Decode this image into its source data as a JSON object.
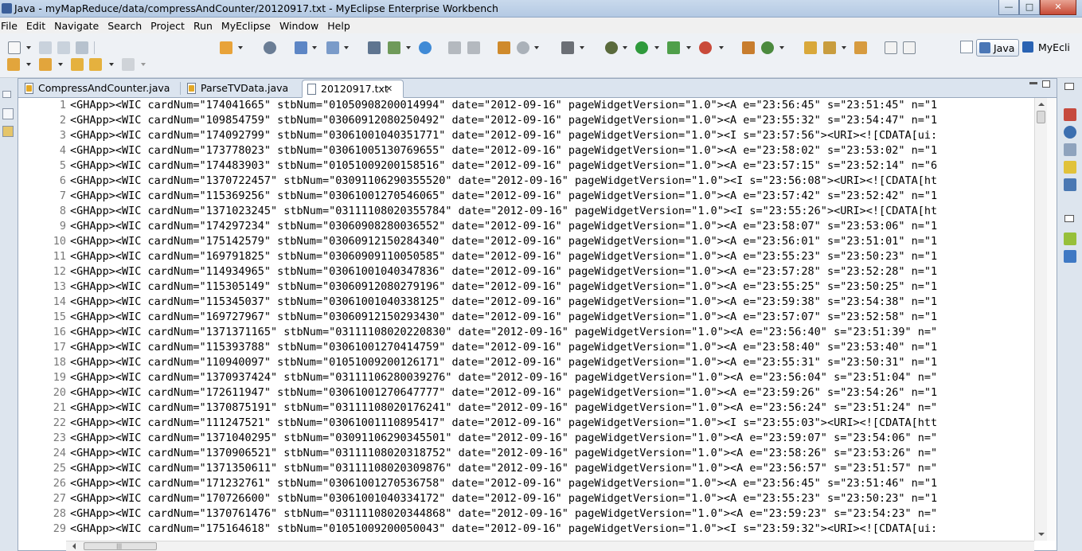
{
  "window": {
    "title": "Java - myMapReduce/data/compressAndCounter/20120917.txt - MyEclipse Enterprise Workbench",
    "minimize": "—",
    "maximize": "□",
    "close": "✕"
  },
  "menu": [
    "File",
    "Edit",
    "Navigate",
    "Search",
    "Project",
    "Run",
    "MyEclipse",
    "Window",
    "Help"
  ],
  "perspectives": {
    "active": "Java",
    "other": "MyEcli"
  },
  "tabs": [
    {
      "label": "CompressAndCounter.java",
      "active": false
    },
    {
      "label": "ParseTVData.java",
      "active": false
    },
    {
      "label": "20120917.txt",
      "active": true,
      "close": "✕"
    }
  ],
  "editor": {
    "lines": [
      {
        "n": "1",
        "t": "<GHApp><WIC cardNum=\"174041665\" stbNum=\"01050908200014994\" date=\"2012-09-16\" pageWidgetVersion=\"1.0\"><A e=\"23:56:45\" s=\"23:51:45\" n=\"1"
      },
      {
        "n": "2",
        "t": "<GHApp><WIC cardNum=\"109854759\" stbNum=\"03060912080250492\" date=\"2012-09-16\" pageWidgetVersion=\"1.0\"><A e=\"23:55:32\" s=\"23:54:47\" n=\"1"
      },
      {
        "n": "3",
        "t": "<GHApp><WIC cardNum=\"174092799\" stbNum=\"03061001040351771\" date=\"2012-09-16\" pageWidgetVersion=\"1.0\"><I s=\"23:57:56\"><URI><![CDATA[ui:"
      },
      {
        "n": "4",
        "t": "<GHApp><WIC cardNum=\"173778023\" stbNum=\"03061005130769655\" date=\"2012-09-16\" pageWidgetVersion=\"1.0\"><A e=\"23:58:02\" s=\"23:53:02\" n=\"1"
      },
      {
        "n": "5",
        "t": "<GHApp><WIC cardNum=\"174483903\" stbNum=\"01051009200158516\" date=\"2012-09-16\" pageWidgetVersion=\"1.0\"><A e=\"23:57:15\" s=\"23:52:14\" n=\"6"
      },
      {
        "n": "6",
        "t": "<GHApp><WIC cardNum=\"1370722457\" stbNum=\"03091106290355520\" date=\"2012-09-16\" pageWidgetVersion=\"1.0\"><I s=\"23:56:08\"><URI><![CDATA[ht"
      },
      {
        "n": "7",
        "t": "<GHApp><WIC cardNum=\"115369256\" stbNum=\"03061001270546065\" date=\"2012-09-16\" pageWidgetVersion=\"1.0\"><A e=\"23:57:42\" s=\"23:52:42\" n=\"1"
      },
      {
        "n": "8",
        "t": "<GHApp><WIC cardNum=\"1371023245\" stbNum=\"03111108020355784\" date=\"2012-09-16\" pageWidgetVersion=\"1.0\"><I s=\"23:55:26\"><URI><![CDATA[ht"
      },
      {
        "n": "9",
        "t": "<GHApp><WIC cardNum=\"174297234\" stbNum=\"03060908280036552\" date=\"2012-09-16\" pageWidgetVersion=\"1.0\"><A e=\"23:58:07\" s=\"23:53:06\" n=\"1"
      },
      {
        "n": "10",
        "t": "<GHApp><WIC cardNum=\"175142579\" stbNum=\"03060912150284340\" date=\"2012-09-16\" pageWidgetVersion=\"1.0\"><A e=\"23:56:01\" s=\"23:51:01\" n=\"1"
      },
      {
        "n": "11",
        "t": "<GHApp><WIC cardNum=\"169791825\" stbNum=\"03060909110050585\" date=\"2012-09-16\" pageWidgetVersion=\"1.0\"><A e=\"23:55:23\" s=\"23:50:23\" n=\"1"
      },
      {
        "n": "12",
        "t": "<GHApp><WIC cardNum=\"114934965\" stbNum=\"03061001040347836\" date=\"2012-09-16\" pageWidgetVersion=\"1.0\"><A e=\"23:57:28\" s=\"23:52:28\" n=\"1"
      },
      {
        "n": "13",
        "t": "<GHApp><WIC cardNum=\"115305149\" stbNum=\"03060912080279196\" date=\"2012-09-16\" pageWidgetVersion=\"1.0\"><A e=\"23:55:25\" s=\"23:50:25\" n=\"1"
      },
      {
        "n": "14",
        "t": "<GHApp><WIC cardNum=\"115345037\" stbNum=\"03061001040338125\" date=\"2012-09-16\" pageWidgetVersion=\"1.0\"><A e=\"23:59:38\" s=\"23:54:38\" n=\"1"
      },
      {
        "n": "15",
        "t": "<GHApp><WIC cardNum=\"169727967\" stbNum=\"03060912150293430\" date=\"2012-09-16\" pageWidgetVersion=\"1.0\"><A e=\"23:57:07\" s=\"23:52:58\" n=\"1"
      },
      {
        "n": "16",
        "t": "<GHApp><WIC cardNum=\"1371371165\" stbNum=\"03111108020220830\" date=\"2012-09-16\" pageWidgetVersion=\"1.0\"><A e=\"23:56:40\" s=\"23:51:39\" n=\""
      },
      {
        "n": "17",
        "t": "<GHApp><WIC cardNum=\"115393788\" stbNum=\"03061001270414759\" date=\"2012-09-16\" pageWidgetVersion=\"1.0\"><A e=\"23:58:40\" s=\"23:53:40\" n=\"1"
      },
      {
        "n": "18",
        "t": "<GHApp><WIC cardNum=\"110940097\" stbNum=\"01051009200126171\" date=\"2012-09-16\" pageWidgetVersion=\"1.0\"><A e=\"23:55:31\" s=\"23:50:31\" n=\"1"
      },
      {
        "n": "19",
        "t": "<GHApp><WIC cardNum=\"1370937424\" stbNum=\"03111106280039276\" date=\"2012-09-16\" pageWidgetVersion=\"1.0\"><A e=\"23:56:04\" s=\"23:51:04\" n=\""
      },
      {
        "n": "20",
        "t": "<GHApp><WIC cardNum=\"172611947\" stbNum=\"03061001270647777\" date=\"2012-09-16\" pageWidgetVersion=\"1.0\"><A e=\"23:59:26\" s=\"23:54:26\" n=\"1"
      },
      {
        "n": "21",
        "t": "<GHApp><WIC cardNum=\"1370875191\" stbNum=\"03111108020176241\" date=\"2012-09-16\" pageWidgetVersion=\"1.0\"><A e=\"23:56:24\" s=\"23:51:24\" n=\""
      },
      {
        "n": "22",
        "t": "<GHApp><WIC cardNum=\"111247521\" stbNum=\"03061001110895417\" date=\"2012-09-16\" pageWidgetVersion=\"1.0\"><I s=\"23:55:03\"><URI><![CDATA[htt"
      },
      {
        "n": "23",
        "t": "<GHApp><WIC cardNum=\"1371040295\" stbNum=\"03091106290345501\" date=\"2012-09-16\" pageWidgetVersion=\"1.0\"><A e=\"23:59:07\" s=\"23:54:06\" n=\""
      },
      {
        "n": "24",
        "t": "<GHApp><WIC cardNum=\"1370906521\" stbNum=\"03111108020318752\" date=\"2012-09-16\" pageWidgetVersion=\"1.0\"><A e=\"23:58:26\" s=\"23:53:26\" n=\""
      },
      {
        "n": "25",
        "t": "<GHApp><WIC cardNum=\"1371350611\" stbNum=\"03111108020309876\" date=\"2012-09-16\" pageWidgetVersion=\"1.0\"><A e=\"23:56:57\" s=\"23:51:57\" n=\""
      },
      {
        "n": "26",
        "t": "<GHApp><WIC cardNum=\"171232761\" stbNum=\"03061001270536758\" date=\"2012-09-16\" pageWidgetVersion=\"1.0\"><A e=\"23:56:45\" s=\"23:51:46\" n=\"1"
      },
      {
        "n": "27",
        "t": "<GHApp><WIC cardNum=\"170726600\" stbNum=\"03061001040334172\" date=\"2012-09-16\" pageWidgetVersion=\"1.0\"><A e=\"23:55:23\" s=\"23:50:23\" n=\"1"
      },
      {
        "n": "28",
        "t": "<GHApp><WIC cardNum=\"1370761476\" stbNum=\"03111108020344868\" date=\"2012-09-16\" pageWidgetVersion=\"1.0\"><A e=\"23:59:23\" s=\"23:54:23\" n=\""
      },
      {
        "n": "29",
        "t": "<GHApp><WIC cardNum=\"175164618\" stbNum=\"01051009200050043\" date=\"2012-09-16\" pageWidgetVersion=\"1.0\"><I s=\"23:59:32\"><URI><![CDATA[ui:"
      }
    ],
    "hscroll_grip": "|||"
  },
  "colors": {
    "line_number": "#787878",
    "editor_bg": "#ffffff",
    "tab_strip": "#dbe4ef"
  }
}
